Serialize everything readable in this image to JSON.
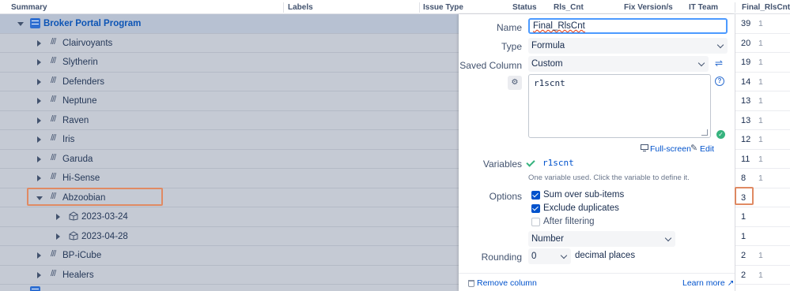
{
  "header": {
    "summary": "Summary",
    "labels": "Labels",
    "issue_type": "Issue Type",
    "status": "Status",
    "rls_cnt": "Rls_Cnt",
    "fix_version": "Fix Version/s",
    "it_team": "IT Team",
    "final_rlscnt": "Final_RlsCnt"
  },
  "tree": {
    "rows": [
      {
        "label": "Broker Portal Program",
        "icon": "program-icon",
        "expanded": true
      },
      {
        "label": "Clairvoyants",
        "icon": "epic-icon"
      },
      {
        "label": "Slytherin",
        "icon": "epic-icon"
      },
      {
        "label": "Defenders",
        "icon": "epic-icon"
      },
      {
        "label": "Neptune",
        "icon": "epic-icon"
      },
      {
        "label": "Raven",
        "icon": "epic-icon"
      },
      {
        "label": "Iris",
        "icon": "epic-icon"
      },
      {
        "label": "Garuda",
        "icon": "epic-icon"
      },
      {
        "label": "Hi-Sense",
        "icon": "epic-icon"
      },
      {
        "label": "Abzoobian",
        "icon": "epic-icon",
        "expanded": true,
        "highlighted": true
      },
      {
        "label": "2023-03-24",
        "icon": "version-icon"
      },
      {
        "label": "2023-04-28",
        "icon": "version-icon"
      },
      {
        "label": "BP-iCube",
        "icon": "epic-icon"
      },
      {
        "label": "Healers",
        "icon": "epic-icon"
      }
    ]
  },
  "final_rlscnt": {
    "rows": [
      {
        "value": "39",
        "sub": "1"
      },
      {
        "value": "20",
        "sub": "1"
      },
      {
        "value": "19",
        "sub": "1"
      },
      {
        "value": "14",
        "sub": "1"
      },
      {
        "value": "13",
        "sub": "1"
      },
      {
        "value": "13",
        "sub": "1"
      },
      {
        "value": "12",
        "sub": "1"
      },
      {
        "value": "11",
        "sub": "1"
      },
      {
        "value": "8",
        "sub": "1"
      },
      {
        "value": "3",
        "sub": ""
      },
      {
        "value": "1",
        "sub": ""
      },
      {
        "value": "1",
        "sub": ""
      },
      {
        "value": "2",
        "sub": "1"
      },
      {
        "value": "2",
        "sub": "1"
      }
    ]
  },
  "panel": {
    "name_label": "Name",
    "name_value": "Final_RlsCnt",
    "type_label": "Type",
    "type_value": "Formula",
    "saved_column_label": "Saved Column",
    "saved_column_value": "Custom",
    "formula": "r1scnt",
    "full_screen": "Full-screen",
    "edit": "Edit",
    "variables_label": "Variables",
    "variable_name": "r1scnt",
    "variables_hint": "One variable used. Click the variable to define it.",
    "options_label": "Options",
    "opt_sum": "Sum over sub-items",
    "opt_exclude": "Exclude duplicates",
    "opt_after": "After filtering",
    "format_value": "Number",
    "rounding_label": "Rounding",
    "rounding_value": "0",
    "decimal_places": "decimal places",
    "remove_column": "Remove column",
    "learn_more": "Learn more ↗"
  }
}
